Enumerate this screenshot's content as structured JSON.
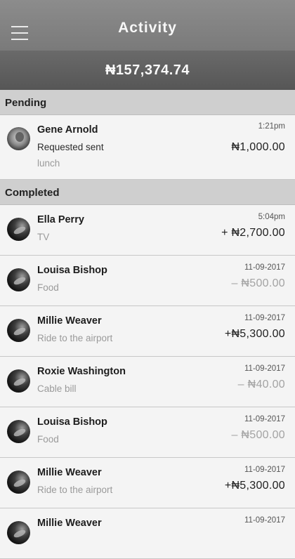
{
  "header": {
    "title": "Activity",
    "menu_icon": "hamburger-menu-icon"
  },
  "balance": "₦157,374.74",
  "sections": {
    "pending": "Pending",
    "completed": "Completed"
  },
  "pending": [
    {
      "name": "Gene Arnold",
      "status": "Requested sent",
      "note": "lunch",
      "time": "1:21pm",
      "amount": "₦1,000.00"
    }
  ],
  "completed": [
    {
      "name": "Ella Perry",
      "note": "TV",
      "time": "5:04pm",
      "amount": "+ ₦2,700.00"
    },
    {
      "name": "Louisa Bishop",
      "note": "Food",
      "time": "11-09-2017",
      "amount": "– ₦500.00"
    },
    {
      "name": "Millie Weaver",
      "note": "Ride to the airport",
      "time": "11-09-2017",
      "amount": "+₦5,300.00"
    },
    {
      "name": "Roxie Washington",
      "note": "Cable bill",
      "time": "11-09-2017",
      "amount": "– ₦40.00"
    },
    {
      "name": "Louisa Bishop",
      "note": "Food",
      "time": "11-09-2017",
      "amount": "– ₦500.00"
    },
    {
      "name": "Millie Weaver",
      "note": "Ride to the airport",
      "time": "11-09-2017",
      "amount": "+₦5,300.00"
    },
    {
      "name": "Millie Weaver",
      "note": "",
      "time": "11-09-2017",
      "amount": ""
    }
  ]
}
